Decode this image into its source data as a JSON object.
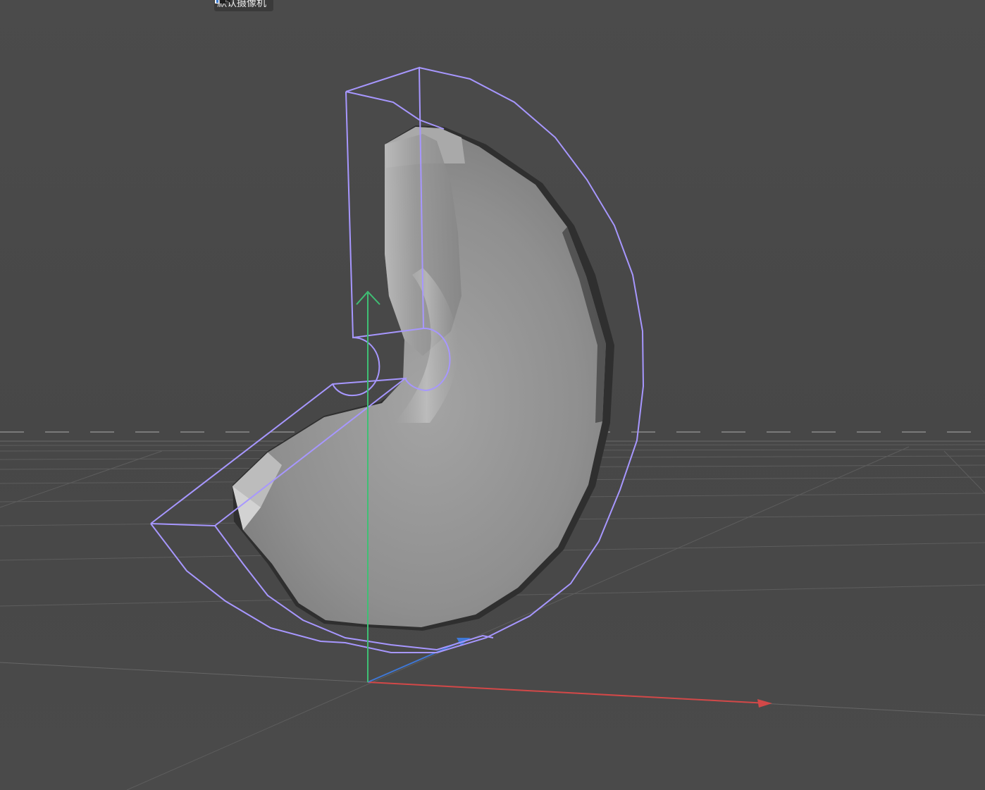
{
  "viewport": {
    "camera_label": "默认摄像机",
    "camera_icon": "camera-icon",
    "colors": {
      "background": "#4a4a4a",
      "grid_line": "#5c5c5c",
      "horizon_dash": "#7a7a7a",
      "selection_outline": "#a797ff",
      "axis_x": "#d24848",
      "axis_y": "#3fbf74",
      "axis_z": "#3f78d6",
      "object_light": "#cfcfcf",
      "object_shadow": "#2e2e2e"
    },
    "object": "bent-tube-object",
    "gizmo": "deformer-cage"
  }
}
